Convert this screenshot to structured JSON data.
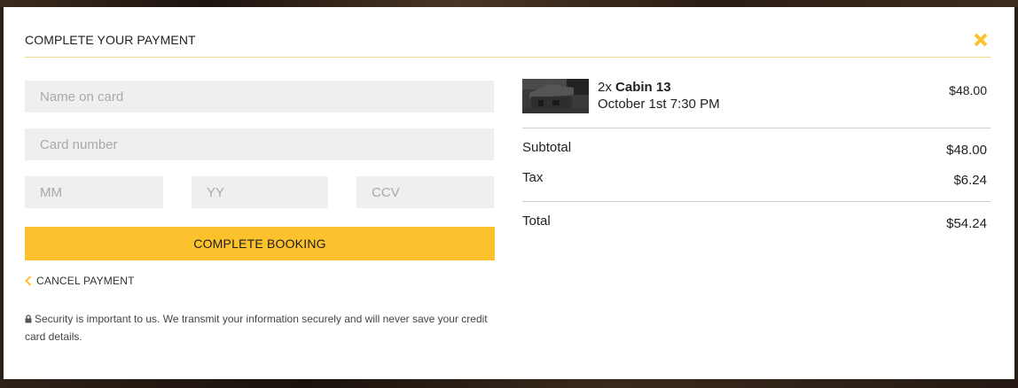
{
  "modal": {
    "title": "COMPLETE YOUR PAYMENT",
    "close_icon": "close-x-icon",
    "accent_color": "#fcc22d"
  },
  "form": {
    "name_placeholder": "Name on card",
    "card_placeholder": "Card number",
    "mm_placeholder": "MM",
    "yy_placeholder": "YY",
    "ccv_placeholder": "CCV",
    "submit_label": "COMPLETE BOOKING",
    "cancel_label": "CANCEL PAYMENT",
    "cancel_icon": "chevron-left-icon",
    "security_icon": "lock-icon",
    "security_text": "Security is important to us. We transmit your information securely and will never save your credit card details."
  },
  "order": {
    "item": {
      "qty": "2x",
      "name": "Cabin 13",
      "datetime": "October 1st 7:30 PM",
      "price": "$48.00"
    },
    "subtotal_label": "Subtotal",
    "subtotal_value": "$48.00",
    "tax_label": "Tax",
    "tax_value": "$6.24",
    "total_label": "Total",
    "total_value": "$54.24"
  }
}
